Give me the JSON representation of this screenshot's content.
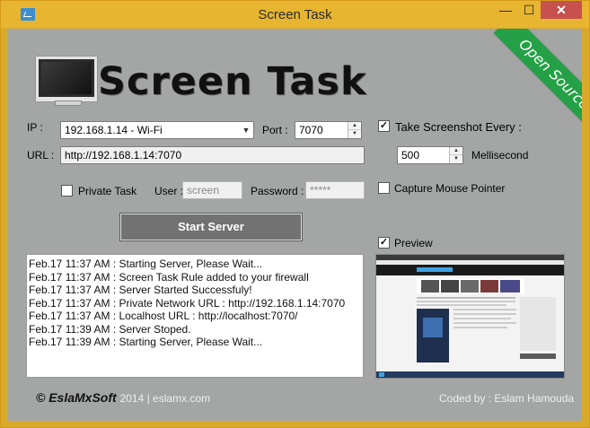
{
  "window": {
    "title": "Screen Task",
    "minimize": "—",
    "maximize": "☐",
    "close": "✕"
  },
  "ribbon": "Open Source",
  "logo_text": "Screen Task",
  "ip": {
    "label": "IP :",
    "value": "192.168.1.14 - Wi-Fi"
  },
  "port": {
    "label": "Port :",
    "value": "7070"
  },
  "url": {
    "label": "URL :",
    "value": "http://192.168.1.14:7070"
  },
  "private_task": {
    "label": "Private Task",
    "checked": false
  },
  "user": {
    "label": "User :",
    "placeholder": "screen"
  },
  "password": {
    "label": "Password :",
    "placeholder": "*****"
  },
  "start_button": "Start Server",
  "screenshot": {
    "label": "Take Screenshot Every :",
    "checked": true,
    "interval": "500",
    "unit": "Mellisecond"
  },
  "capture_mouse": {
    "label": "Capture Mouse Pointer",
    "checked": false
  },
  "preview": {
    "label": "Preview",
    "checked": true
  },
  "log": [
    "Feb.17 11:37 AM : Starting Server, Please Wait...",
    "Feb.17 11:37 AM : Screen Task Rule added to your firewall",
    "Feb.17 11:37 AM : Server Started Successfuly!",
    "Feb.17 11:37 AM : Private Network URL : http://192.168.1.14:7070",
    "Feb.17 11:37 AM : Localhost URL : http://localhost:7070/",
    "Feb.17 11:39 AM : Server Stoped.",
    "Feb.17 11:39 AM : Starting Server, Please Wait..."
  ],
  "footer": {
    "brand": "EslaMxSoft",
    "year_site": "2014 | eslamx.com",
    "credit": "Coded by : Eslam Hamouda"
  },
  "colors": {
    "title_bar": "#e8b531",
    "client_bg": "#a4a6a6",
    "ribbon": "#24a146",
    "close_button": "#c7514e",
    "start_button": "#727272"
  }
}
